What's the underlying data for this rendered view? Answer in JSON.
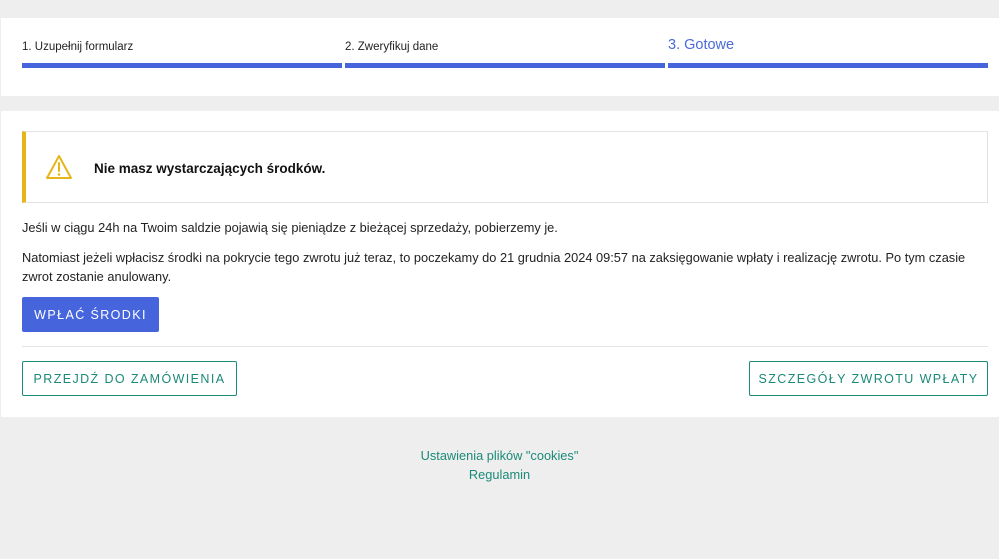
{
  "stepper": {
    "steps": [
      {
        "label": "1. Uzupełnij formularz"
      },
      {
        "label": "2. Zweryfikuj dane"
      },
      {
        "label": "3. Gotowe"
      }
    ]
  },
  "alert": {
    "icon": "warning-triangle-icon",
    "message": "Nie masz wystarczających środków.",
    "accent_color": "#e6b619"
  },
  "info": {
    "paragraph1": "Jeśli w ciągu 24h na Twoim saldzie pojawią się pieniądze z bieżącej sprzedaży, pobierzemy je.",
    "paragraph2": "Natomiast jeżeli wpłacisz środki na pokrycie tego zwrotu już teraz, to poczekamy do 21 grudnia 2024 09:57 na zaksięgowanie wpłaty i realizację zwrotu. Po tym czasie zwrot zostanie anulowany."
  },
  "actions": {
    "pay_label": "WPŁAĆ ŚRODKI",
    "go_to_order_label": "PRZEJDŹ DO ZAMÓWIENIA",
    "refund_details_label": "SZCZEGÓŁY ZWROTU WPŁATY"
  },
  "footer": {
    "cookies_link": "Ustawienia plików \"cookies\"",
    "terms_link": "Regulamin"
  },
  "colors": {
    "primary": "#4665dc",
    "secondary": "#1b8a78",
    "warning": "#e6b619"
  }
}
